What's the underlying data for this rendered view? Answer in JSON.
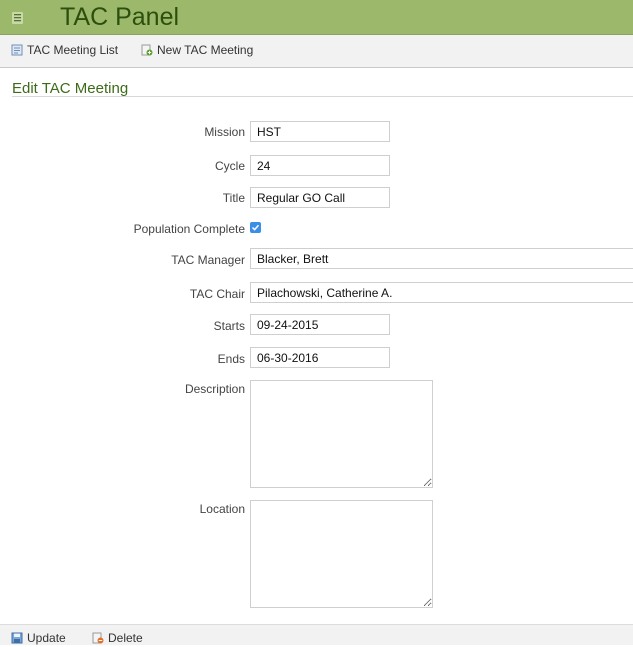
{
  "app": {
    "title": "TAC Panel"
  },
  "toolbar": {
    "list_label": "TAC Meeting List",
    "new_label": "New TAC Meeting"
  },
  "form": {
    "heading": "Edit TAC Meeting",
    "mission_label": "Mission",
    "mission_value": "HST",
    "cycle_label": "Cycle",
    "cycle_value": "24",
    "title_label": "Title",
    "title_value": "Regular GO Call",
    "population_label": "Population Complete",
    "population_checked": true,
    "manager_label": "TAC Manager",
    "manager_value": "Blacker, Brett",
    "chair_label": "TAC Chair",
    "chair_value": "Pilachowski, Catherine A.",
    "starts_label": "Starts",
    "starts_value": "09-24-2015",
    "ends_label": "Ends",
    "ends_value": "06-30-2016",
    "description_label": "Description",
    "description_value": "",
    "location_label": "Location",
    "location_value": ""
  },
  "footer": {
    "update_label": "Update",
    "delete_label": "Delete"
  },
  "colors": {
    "header_bg": "#9cb86a",
    "header_text": "#2d4f0e",
    "section_heading": "#3d6b1a",
    "checkbox": "#3a8ee6"
  },
  "icons": {
    "menu": "list-icon",
    "list": "document-list-icon",
    "new": "add-document-icon",
    "update": "save-icon",
    "delete": "delete-icon"
  }
}
